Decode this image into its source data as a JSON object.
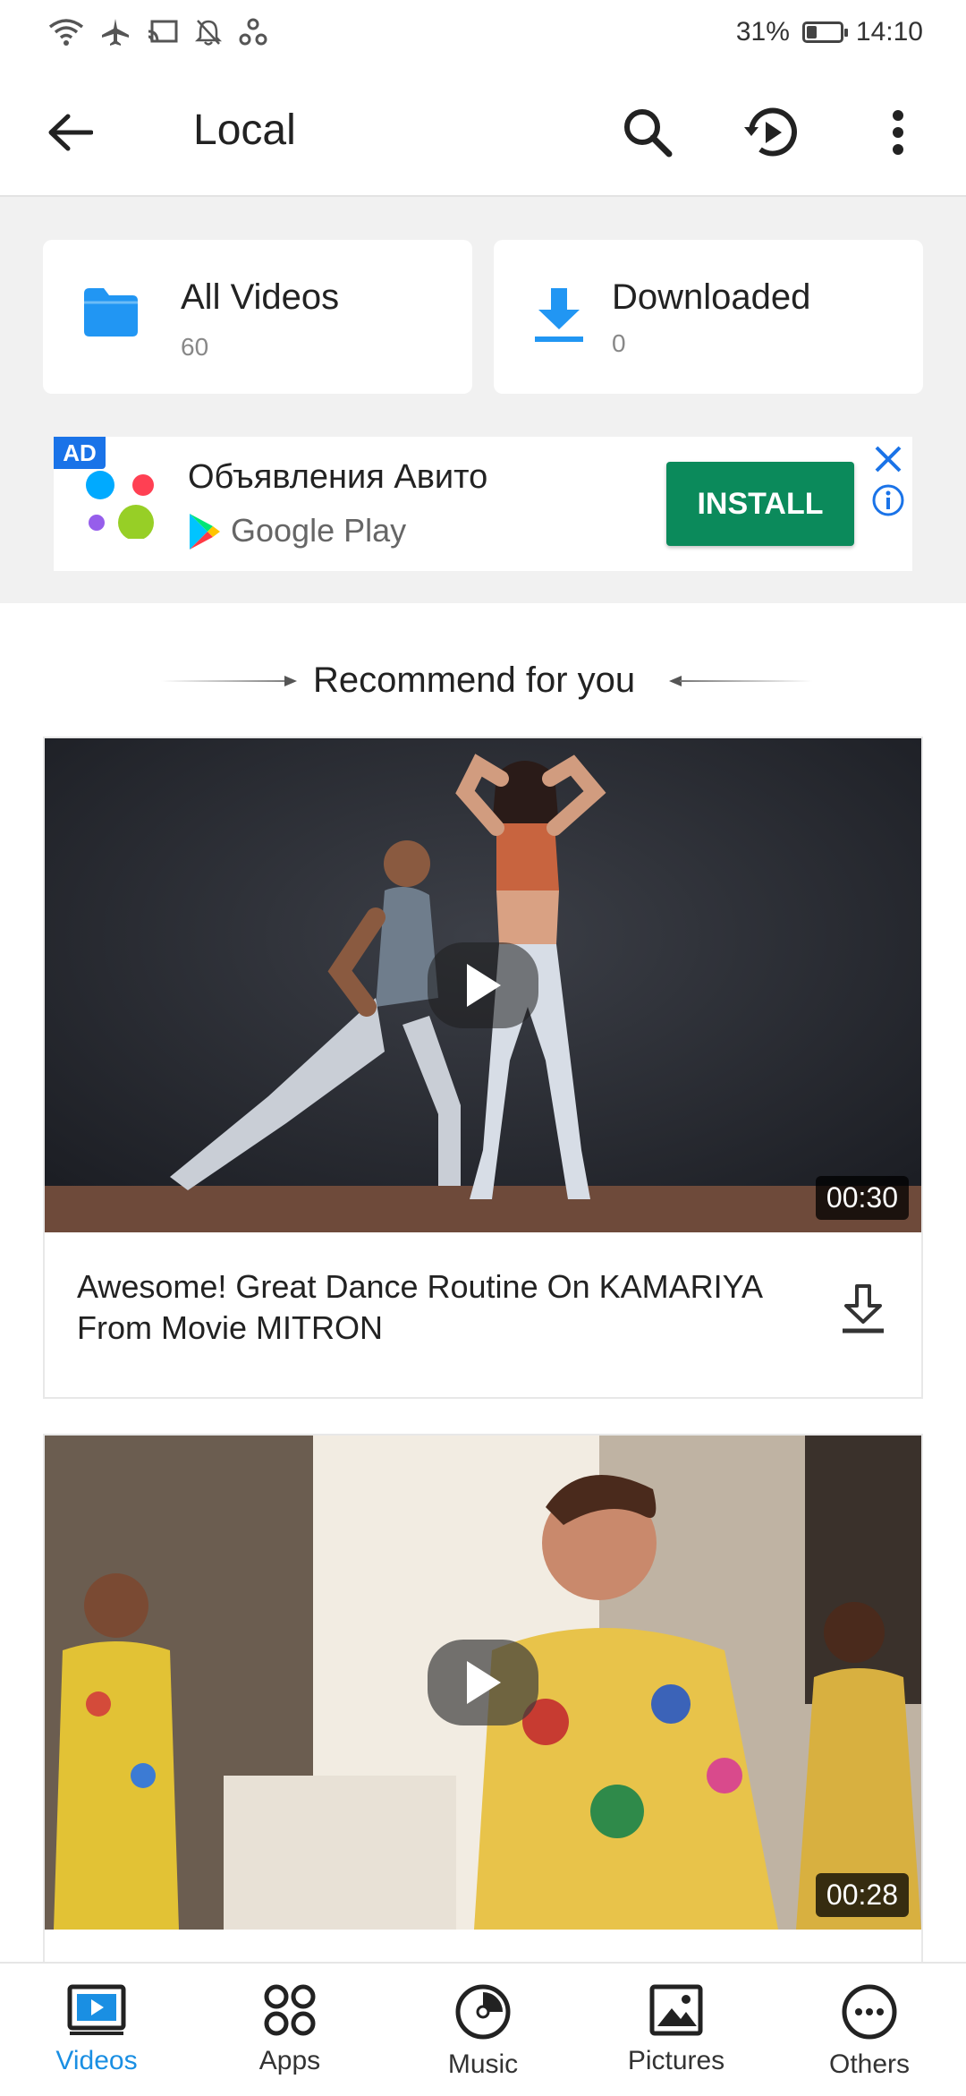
{
  "status_bar": {
    "battery_text": "31%",
    "battery_level": 0.31,
    "time": "14:10",
    "icons": [
      "wifi-icon",
      "airplane-mode-icon",
      "cast-icon",
      "notifications-off-icon",
      "sync-icon"
    ]
  },
  "app_bar": {
    "title": "Local",
    "icons": [
      "back-arrow-icon",
      "search-icon",
      "history-play-icon",
      "more-vert-icon"
    ]
  },
  "folders": [
    {
      "title": "All Videos",
      "count": "60",
      "icon": "folder-icon",
      "color": "#2196f3"
    },
    {
      "title": "Downloaded",
      "count": "0",
      "icon": "download-icon",
      "color": "#2196f3"
    }
  ],
  "ad": {
    "badge": "AD",
    "title": "Объявления Авито",
    "store": "Google Play",
    "install_label": "INSTALL",
    "accent": "#0b8a5b"
  },
  "recommend": {
    "title": "Recommend for you"
  },
  "videos": [
    {
      "title": "Awesome! Great Dance Routine On KAMARIYA From Movie MITRON",
      "duration": "00:30"
    },
    {
      "title": "",
      "duration": "00:28"
    }
  ],
  "bottom_nav": {
    "active": "Videos",
    "accent": "#1a8fe3",
    "items": [
      {
        "label": "Videos",
        "icon": "videos-icon"
      },
      {
        "label": "Apps",
        "icon": "apps-icon"
      },
      {
        "label": "Music",
        "icon": "music-icon"
      },
      {
        "label": "Pictures",
        "icon": "pictures-icon"
      },
      {
        "label": "Others",
        "icon": "others-icon"
      }
    ]
  }
}
